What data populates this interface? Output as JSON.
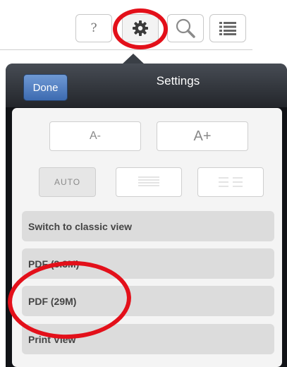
{
  "toolbar": {
    "help_label": "?",
    "buttons": [
      "help-button",
      "gear-icon",
      "search-icon",
      "list-icon"
    ]
  },
  "settings": {
    "done_label": "Done",
    "title": "Settings",
    "font_decrease": "A-",
    "font_increase": "A+",
    "layout_auto": "AUTO",
    "menu": [
      {
        "label": "Switch to classic view"
      },
      {
        "label": "PDF (3.3M)"
      },
      {
        "label": "PDF (29M)"
      },
      {
        "label": "Print View"
      }
    ]
  },
  "colors": {
    "highlight": "#e3101a",
    "done_button": "#4f7fc3",
    "menu_item_bg": "#dcdcdc",
    "popover_bg": "#111317"
  }
}
